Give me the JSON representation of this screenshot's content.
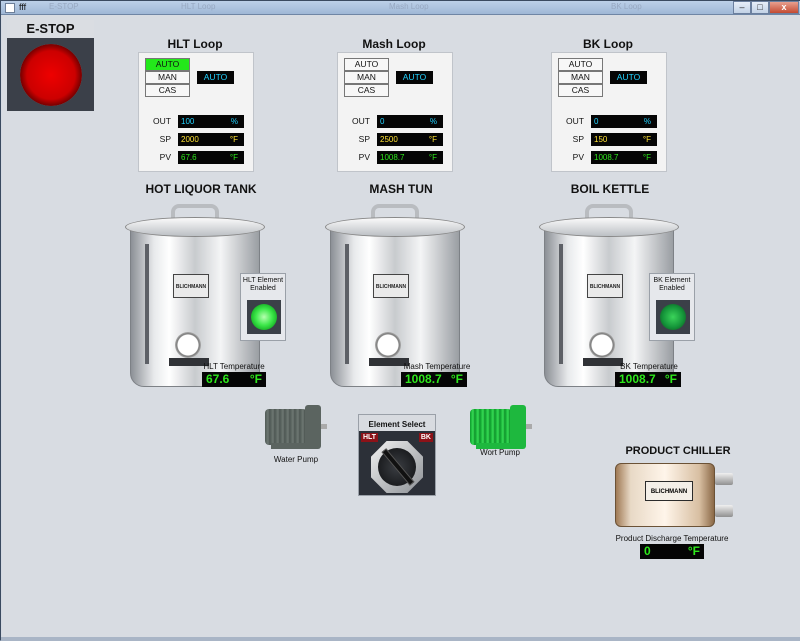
{
  "window": {
    "title": "fff",
    "ghost_tabs": [
      "E-STOP",
      "HLT Loop",
      "Mash Loop",
      "BK Loop"
    ],
    "minimize": "–",
    "maximize": "□",
    "close": "x"
  },
  "estop": {
    "label": "E-STOP",
    "color": "#e00000"
  },
  "loops": [
    {
      "title": "HLT Loop",
      "modes": [
        "AUTO",
        "MAN",
        "CAS"
      ],
      "active_mode": "AUTO",
      "mode_display": "AUTO",
      "out_label": "OUT",
      "out_value": "100",
      "out_unit": "%",
      "sp_label": "SP",
      "sp_value": "2000",
      "sp_unit": "°F",
      "pv_label": "PV",
      "pv_value": "67.6",
      "pv_unit": "°F"
    },
    {
      "title": "Mash Loop",
      "modes": [
        "AUTO",
        "MAN",
        "CAS"
      ],
      "active_mode": "",
      "mode_display": "AUTO",
      "out_label": "OUT",
      "out_value": "0",
      "out_unit": "%",
      "sp_label": "SP",
      "sp_value": "2500",
      "sp_unit": "°F",
      "pv_label": "PV",
      "pv_value": "1008.7",
      "pv_unit": "°F"
    },
    {
      "title": "BK Loop",
      "modes": [
        "AUTO",
        "MAN",
        "CAS"
      ],
      "active_mode": "",
      "mode_display": "AUTO",
      "out_label": "OUT",
      "out_value": "0",
      "out_unit": "%",
      "sp_label": "SP",
      "sp_value": "150",
      "sp_unit": "°F",
      "pv_label": "PV",
      "pv_value": "1008.7",
      "pv_unit": "°F"
    }
  ],
  "tanks": [
    {
      "title": "HOT LIQUOR TANK",
      "logo": "BLICHMANN",
      "temp_label": "HLT Temperature",
      "temp_value": "67.6",
      "temp_unit": "°F"
    },
    {
      "title": "MASH TUN",
      "logo": "BLICHMANN",
      "temp_label": "Mash Temperature",
      "temp_value": "1008.7",
      "temp_unit": "°F"
    },
    {
      "title": "BOIL KETTLE",
      "logo": "BLICHMANN",
      "temp_label": "BK Temperature",
      "temp_value": "1008.7",
      "temp_unit": "°F"
    }
  ],
  "elements": [
    {
      "label": "HLT Element Enabled",
      "state": "on"
    },
    {
      "label": "BK Element Enabled",
      "state": "off"
    }
  ],
  "pumps": {
    "water": {
      "label": "Water Pump",
      "state": "off",
      "color": "#5b6460"
    },
    "wort": {
      "label": "Wort Pump",
      "state": "on",
      "color": "#1eb83e"
    }
  },
  "element_select": {
    "title": "Element Select",
    "left_option": "HLT",
    "right_option": "BK",
    "selected": "HLT"
  },
  "chiller": {
    "title": "PRODUCT CHILLER",
    "logo": "BLICHMANN",
    "temp_label": "Product Discharge Temperature",
    "temp_value": "0",
    "temp_unit": "°F"
  }
}
